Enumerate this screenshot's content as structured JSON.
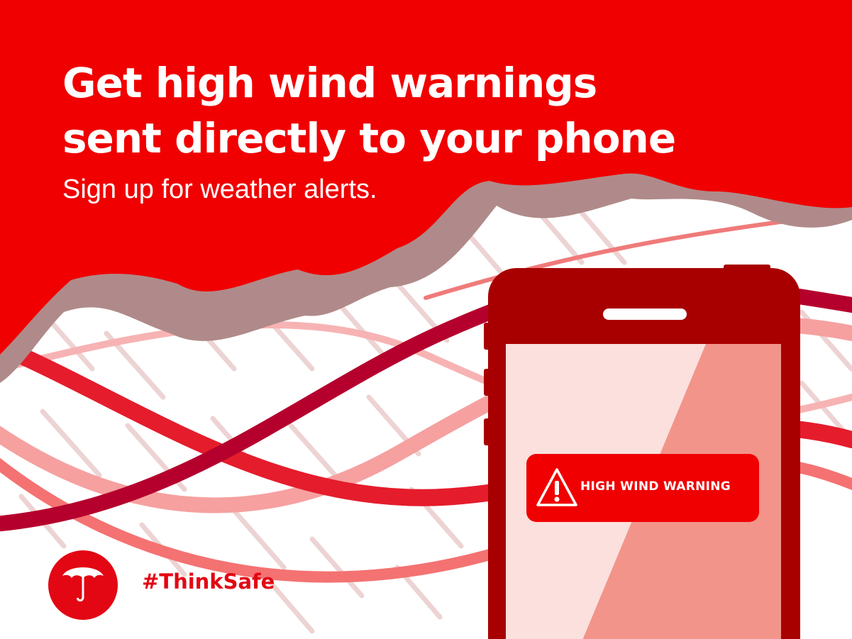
{
  "headline": {
    "line1": "Get high wind warnings",
    "line2": "sent directly to your phone"
  },
  "subhead": "Sign up for weather alerts.",
  "alert": {
    "label": "HIGH WIND WARNING",
    "icon": "warning-triangle-icon"
  },
  "brand": {
    "hashtag": "#ThinkSafe",
    "logo_icon": "umbrella-icon"
  },
  "colors": {
    "brand_red": "#e30613",
    "cloud_shadow": "#b08a8a",
    "phone_body": "#a80000",
    "screen_light": "#fbe0de",
    "screen_dark": "#f2948a"
  }
}
